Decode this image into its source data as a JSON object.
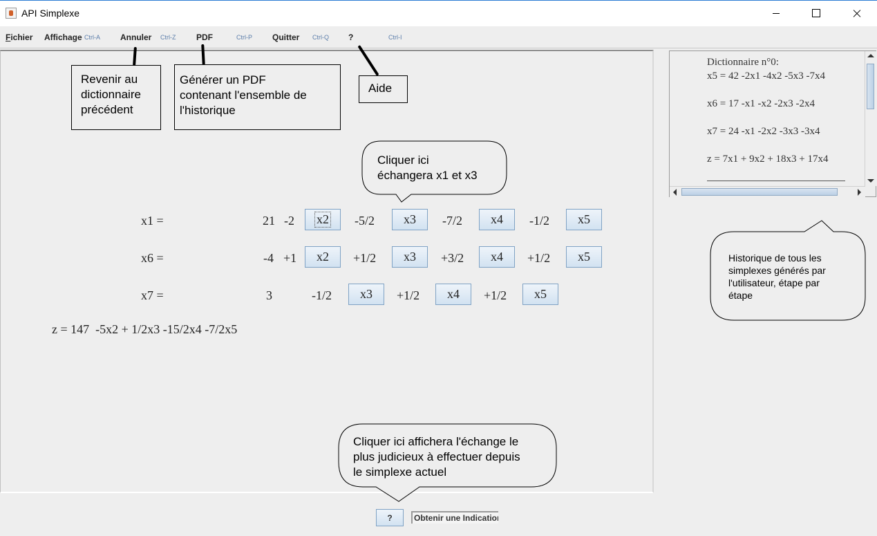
{
  "window": {
    "title": "API Simplexe"
  },
  "menu": {
    "fichier": "Fichier",
    "affichage": "Affichage",
    "affichage_accel": "Ctrl-A",
    "annuler": "Annuler",
    "annuler_accel": "Ctrl-Z",
    "pdf": "PDF",
    "pdf_accel": "Ctrl-P",
    "quitter": "Quitter",
    "quitter_accel": "Ctrl-Q",
    "aide": "?",
    "aide_accel": "Ctrl-I"
  },
  "callouts": {
    "annuler": [
      "Revenir au",
      "dictionnaire",
      "précédent"
    ],
    "pdf": [
      "Générer un PDF",
      "contenant l'ensemble de",
      "l'historique"
    ],
    "aide": "Aide",
    "swap": [
      "Cliquer ici",
      "échangera x1 et x3"
    ],
    "history": [
      "Historique de tous les",
      "simplexes générés par",
      "l'utilisateur, étape par",
      "étape"
    ],
    "hint": [
      "Cliquer ici affichera l'échange le",
      "plus judicieux à effectuer depuis",
      "le simplexe actuel"
    ]
  },
  "equations": {
    "row1": {
      "label": "x1 =",
      "constant": "21",
      "terms": [
        {
          "coef": "-2",
          "var": "x2"
        },
        {
          "coef": "-5/2",
          "var": "x3"
        },
        {
          "coef": "-7/2",
          "var": "x4"
        },
        {
          "coef": "-1/2",
          "var": "x5"
        }
      ]
    },
    "row2": {
      "label": "x6 =",
      "constant": "-4",
      "terms": [
        {
          "coef": "+1",
          "var": "x2"
        },
        {
          "coef": "+1/2",
          "var": "x3"
        },
        {
          "coef": "+3/2",
          "var": "x4"
        },
        {
          "coef": "+1/2",
          "var": "x5"
        }
      ]
    },
    "row3": {
      "label": "x7 =",
      "constant": "3",
      "terms": [
        {
          "coef": "-1/2",
          "var": "x3"
        },
        {
          "coef": "+1/2",
          "var": "x4"
        },
        {
          "coef": "+1/2",
          "var": "x5"
        }
      ]
    },
    "objective": "z = 147  -5x2 + 1/2x3 -15/2x4 -7/2x5"
  },
  "history": {
    "title": "Dictionnaire n°0:",
    "lines": [
      "x5 = 42 -2x1 -4x2 -5x3 -7x4",
      "x6 = 17 -x1 -x2 -2x3 -2x4",
      "x7 = 24 -x1 -2x2 -3x3 -3x4",
      "z = 7x1 + 9x2 + 18x3 + 17x4"
    ]
  },
  "hint": {
    "button_label": "?",
    "text": "Obtenir une Indication"
  }
}
